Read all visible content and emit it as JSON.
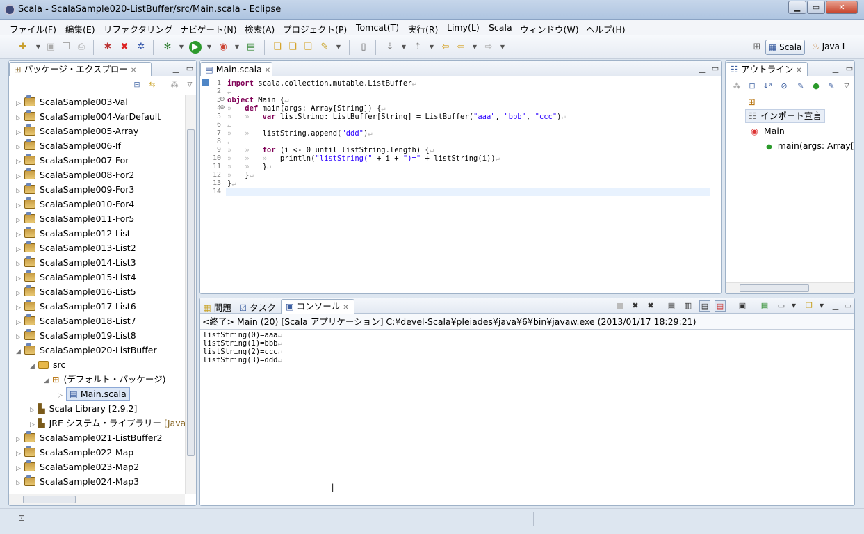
{
  "window": {
    "title": "Scala - ScalaSample020-ListBuffer/src/Main.scala - Eclipse",
    "minimize": "▁",
    "maximize": "▭",
    "close": "✕"
  },
  "menu": [
    "ファイル(F)",
    "編集(E)",
    "リファクタリング",
    "ナビゲート(N)",
    "検索(A)",
    "プロジェクト(P)",
    "Tomcat(T)",
    "実行(R)",
    "Limy(L)",
    "Scala",
    "ウィンドウ(W)",
    "ヘルプ(H)"
  ],
  "perspectives": {
    "scala": "Scala",
    "java": "Java I"
  },
  "package_explorer": {
    "tab_label": "パッケージ・エクスプロー",
    "projects_before": [
      "ScalaSample003-Val",
      "ScalaSample004-VarDefault",
      "ScalaSample005-Array",
      "ScalaSample006-If",
      "ScalaSample007-For",
      "ScalaSample008-For2",
      "ScalaSample009-For3",
      "ScalaSample010-For4",
      "ScalaSample011-For5",
      "ScalaSample012-List",
      "ScalaSample013-List2",
      "ScalaSample014-List3",
      "ScalaSample015-List4",
      "ScalaSample016-List5",
      "ScalaSample017-List6",
      "ScalaSample018-List7",
      "ScalaSample019-List8"
    ],
    "open_project": "ScalaSample020-ListBuffer",
    "src": "src",
    "default_package": "(デフォルト・パッケージ)",
    "file": "Main.scala",
    "scala_library": "Scala Library [2.9.2]",
    "jre": "JRE システム・ライブラリー",
    "jre_suffix": "[Java",
    "projects_after": [
      "ScalaSample021-ListBuffer2",
      "ScalaSample022-Map",
      "ScalaSample023-Map2",
      "ScalaSample024-Map3"
    ]
  },
  "editor": {
    "tab_label": "Main.scala",
    "line_numbers": [
      "1",
      "2",
      "3",
      "4",
      "5",
      "6",
      "7",
      "8",
      "9",
      "10",
      "11",
      "12",
      "13",
      "14"
    ]
  },
  "outline": {
    "tab_label": "アウトライン",
    "imports": "インポート宣言",
    "object": "Main",
    "method": "main(args: Array["
  },
  "bottom": {
    "tab_problems": "問題",
    "tab_tasks": "タスク",
    "tab_console": "コンソール",
    "header": "<終了> Main (20) [Scala アプリケーション] C:¥devel-Scala¥pleiades¥java¥6¥bin¥javaw.exe (2013/01/17 18:29:21)",
    "output": [
      "listString(0)=aaa",
      "listString(1)=bbb",
      "listString(2)=ccc",
      "listString(3)=ddd"
    ]
  }
}
